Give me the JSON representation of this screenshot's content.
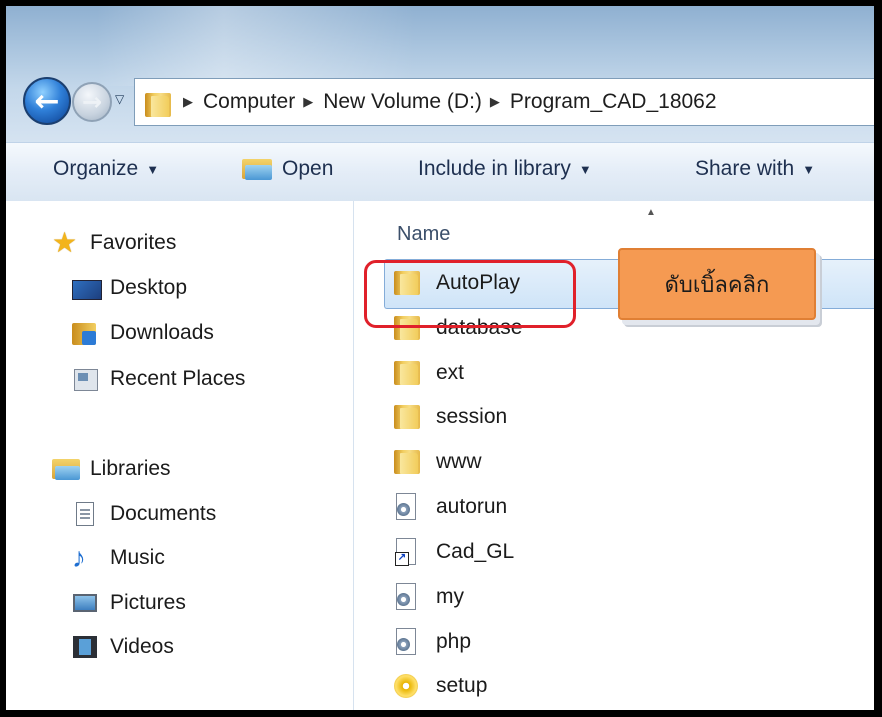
{
  "nav": {
    "back_glyph": "←",
    "forward_glyph": "→"
  },
  "address": {
    "crumbs": [
      "Computer",
      "New Volume (D:)",
      "Program_CAD_18062"
    ]
  },
  "toolbar": {
    "organize": "Organize",
    "open": "Open",
    "include": "Include in library",
    "share": "Share with"
  },
  "navpane": {
    "favorites": "Favorites",
    "desktop": "Desktop",
    "downloads": "Downloads",
    "recent": "Recent Places",
    "libraries": "Libraries",
    "documents": "Documents",
    "music": "Music",
    "pictures": "Pictures",
    "videos": "Videos"
  },
  "content": {
    "column_name": "Name",
    "files": [
      {
        "name": "AutoPlay",
        "icon": "folder-icon"
      },
      {
        "name": "database",
        "icon": "folder-icon"
      },
      {
        "name": "ext",
        "icon": "folder-icon"
      },
      {
        "name": "session",
        "icon": "folder-icon"
      },
      {
        "name": "www",
        "icon": "folder-icon"
      },
      {
        "name": "autorun",
        "icon": "settings-file-icon"
      },
      {
        "name": "Cad_GL",
        "icon": "shortcut-icon"
      },
      {
        "name": "my",
        "icon": "settings-file-icon"
      },
      {
        "name": "php",
        "icon": "settings-file-icon"
      },
      {
        "name": "setup",
        "icon": "setup-disc-icon"
      }
    ],
    "callout": "ดับเบิ้ลคลิก"
  }
}
